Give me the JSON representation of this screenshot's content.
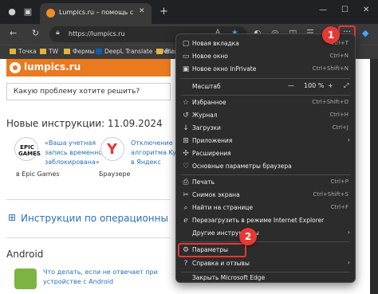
{
  "browser": {
    "tab_title": "Lumpics.ru – помощь с компь",
    "url": "https://lumpics.ru",
    "favorites": [
      "Точка",
      "TW",
      "Фермы",
      "DeepL Translate – Der…",
      "Blen"
    ]
  },
  "page": {
    "logo": "lumpics.ru",
    "search_placeholder": "Какую проблему хотите решить?",
    "heading": "Новые инструкции: 11.09.2024",
    "card1_lines": [
      "«Ваша учетная",
      "запись временно",
      "заблокирована»"
    ],
    "card1_sub": "в Epic Games",
    "card1_logo": "EPIC GAMES",
    "card2_lines": [
      "Отключение",
      "алгоритма Kyb",
      "в Яндекс"
    ],
    "card2_sub": "Браузере",
    "section": "Инструкции по операционны",
    "android_heading": "Android",
    "android_lines": [
      "Что делать, если не отвечает при",
      "устройстве с Android"
    ]
  },
  "menu": {
    "items": [
      {
        "label": "Новая вкладка",
        "shortcut": "Ctrl+T",
        "icon": "new-tab-icon",
        "glyph": "▢"
      },
      {
        "label": "Новое окно",
        "shortcut": "Ctrl+N",
        "icon": "new-window-icon",
        "glyph": "▭"
      },
      {
        "label": "Новое окно InPrivate",
        "shortcut": "Ctrl+Shift+N",
        "icon": "inprivate-icon",
        "glyph": "▣"
      },
      {
        "label": "Избранное",
        "shortcut": "Ctrl+Shift+O",
        "icon": "favorites-icon",
        "glyph": "☆"
      },
      {
        "label": "Журнал",
        "shortcut": "Ctrl+H",
        "icon": "history-icon",
        "glyph": "↺"
      },
      {
        "label": "Загрузки",
        "shortcut": "Ctrl+J",
        "icon": "downloads-icon",
        "glyph": "↓"
      },
      {
        "label": "Приложения",
        "shortcut": "",
        "icon": "apps-icon",
        "glyph": "⊞",
        "submenu": true
      },
      {
        "label": "Расширения",
        "shortcut": "",
        "icon": "extensions-icon",
        "glyph": "✣"
      },
      {
        "label": "Основные параметры браузера",
        "shortcut": "",
        "icon": "essentials-icon",
        "glyph": "♡"
      },
      {
        "label": "Печать",
        "shortcut": "Ctrl+P",
        "icon": "print-icon",
        "glyph": "⎙"
      },
      {
        "label": "Снимок экрана",
        "shortcut": "Ctrl+Shift+S",
        "icon": "screenshot-icon",
        "glyph": "✂"
      },
      {
        "label": "Найти на странице",
        "shortcut": "Ctrl+F",
        "icon": "find-icon",
        "glyph": "⌕"
      },
      {
        "label": "Перезагрузить в режиме Internet Explorer",
        "shortcut": "",
        "icon": "ie-mode-icon",
        "glyph": "ℯ"
      },
      {
        "label": "Другие инструменты",
        "shortcut": "",
        "icon": "more-tools-icon",
        "glyph": "",
        "submenu": true
      },
      {
        "label": "Параметры",
        "shortcut": "",
        "icon": "settings-icon",
        "glyph": "⚙"
      },
      {
        "label": "Справка и отзывы",
        "shortcut": "",
        "icon": "help-icon",
        "glyph": "?",
        "submenu": true
      },
      {
        "label": "Закрыть Microsoft Edge",
        "shortcut": "",
        "icon": "close-edge-icon",
        "glyph": ""
      }
    ],
    "zoom_label": "Масштаб",
    "zoom_minus": "—",
    "zoom_value": "100 %",
    "zoom_plus": "+"
  },
  "badges": [
    "1",
    "2"
  ],
  "colors": {
    "accent": "#e53935",
    "brand": "#e97a1f",
    "link": "#2a6ebb"
  }
}
